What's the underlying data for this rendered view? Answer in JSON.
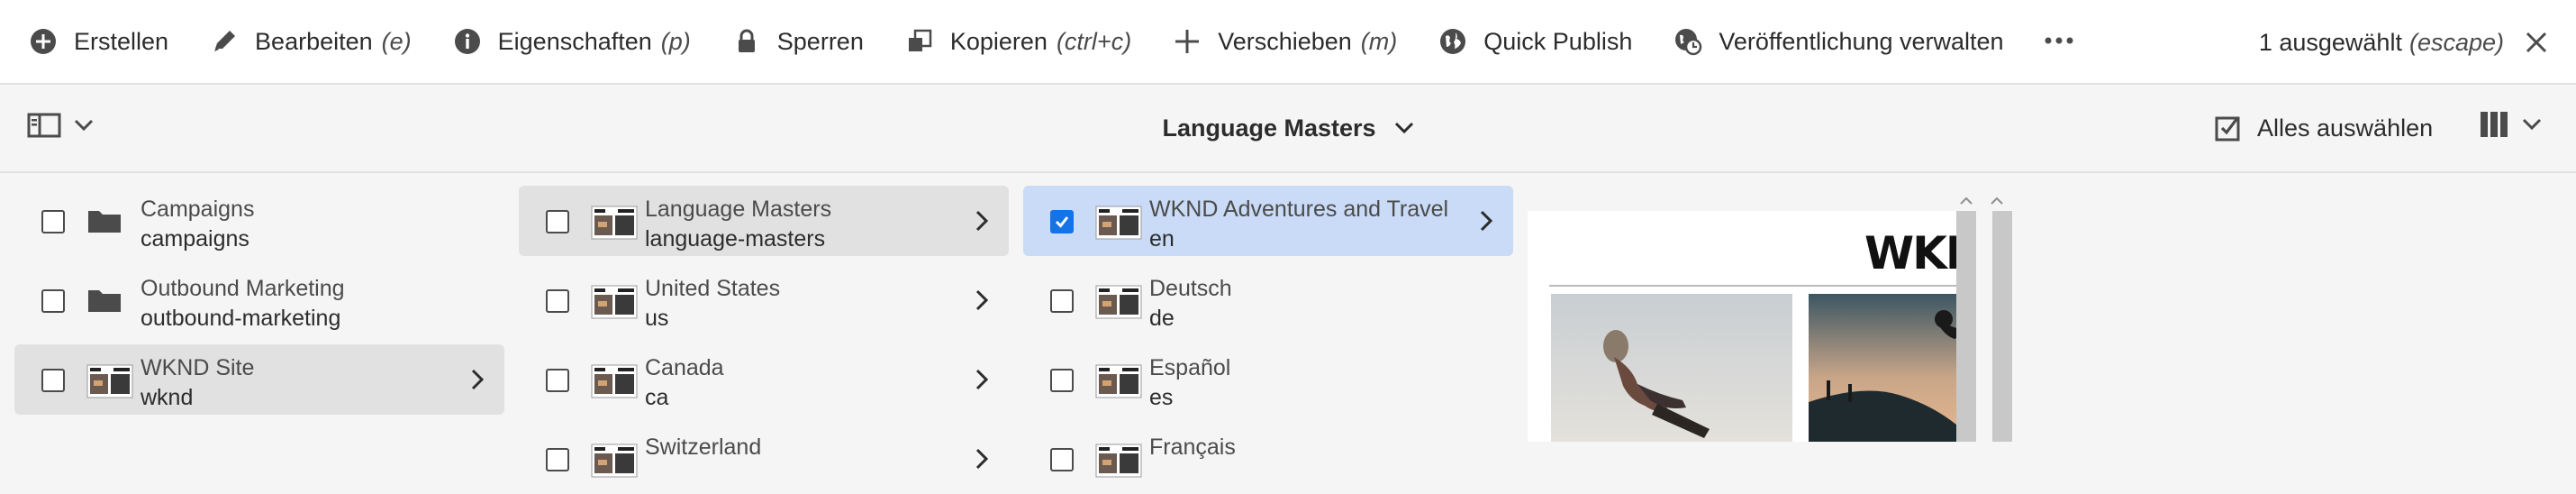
{
  "toolbar": {
    "actions": [
      {
        "label": "Erstellen",
        "shortcut": "",
        "icon": "add-circle-icon"
      },
      {
        "label": "Bearbeiten",
        "shortcut": "(e)",
        "icon": "pencil-icon"
      },
      {
        "label": "Eigenschaften",
        "shortcut": "(p)",
        "icon": "info-icon"
      },
      {
        "label": "Sperren",
        "shortcut": "",
        "icon": "lock-icon"
      },
      {
        "label": "Kopieren",
        "shortcut": "(ctrl+c)",
        "icon": "copy-icon"
      },
      {
        "label": "Verschieben",
        "shortcut": "(m)",
        "icon": "move-icon"
      },
      {
        "label": "Quick Publish",
        "shortcut": "",
        "icon": "globe-icon"
      },
      {
        "label": "Veröffentlichung verwalten",
        "shortcut": "",
        "icon": "globe-clock-icon"
      }
    ],
    "more_icon": "more-icon",
    "selection": {
      "label": "1 ausgewählt",
      "shortcut": "(escape)",
      "close_icon": "close-icon"
    }
  },
  "titlebar": {
    "rail_icon": "rail-toggle-icon",
    "title": "Language Masters",
    "select_all": "Alles auswählen",
    "view_icon": "column-view-icon"
  },
  "columns": [
    {
      "items": [
        {
          "title": "Campaigns",
          "name": "campaigns",
          "type": "folder",
          "state": "none",
          "chevron": false
        },
        {
          "title": "Outbound Marketing",
          "name": "outbound-marketing",
          "type": "folder",
          "state": "none",
          "chevron": false
        },
        {
          "title": "WKND Site",
          "name": "wknd",
          "type": "page",
          "state": "highlighted",
          "chevron": true
        }
      ]
    },
    {
      "items": [
        {
          "title": "Language Masters",
          "name": "language-masters",
          "type": "page",
          "state": "highlighted",
          "chevron": true
        },
        {
          "title": "United States",
          "name": "us",
          "type": "page",
          "state": "none",
          "chevron": true
        },
        {
          "title": "Canada",
          "name": "ca",
          "type": "page",
          "state": "none",
          "chevron": true
        },
        {
          "title": "Switzerland",
          "name": "",
          "type": "page",
          "state": "none",
          "chevron": true
        }
      ]
    },
    {
      "items": [
        {
          "title": "WKND Adventures and Travel",
          "name": "en",
          "type": "page",
          "state": "selected",
          "chevron": true
        },
        {
          "title": "Deutsch",
          "name": "de",
          "type": "page",
          "state": "none",
          "chevron": false
        },
        {
          "title": "Español",
          "name": "es",
          "type": "page",
          "state": "none",
          "chevron": false
        },
        {
          "title": "Français",
          "name": "",
          "type": "page",
          "state": "none",
          "chevron": false
        }
      ]
    }
  ],
  "preview": {
    "logo": "WKND"
  },
  "colors": {
    "accent": "#1473e6",
    "selected_row": "#c9dbf6",
    "highlight_row": "#e1e1e1"
  }
}
